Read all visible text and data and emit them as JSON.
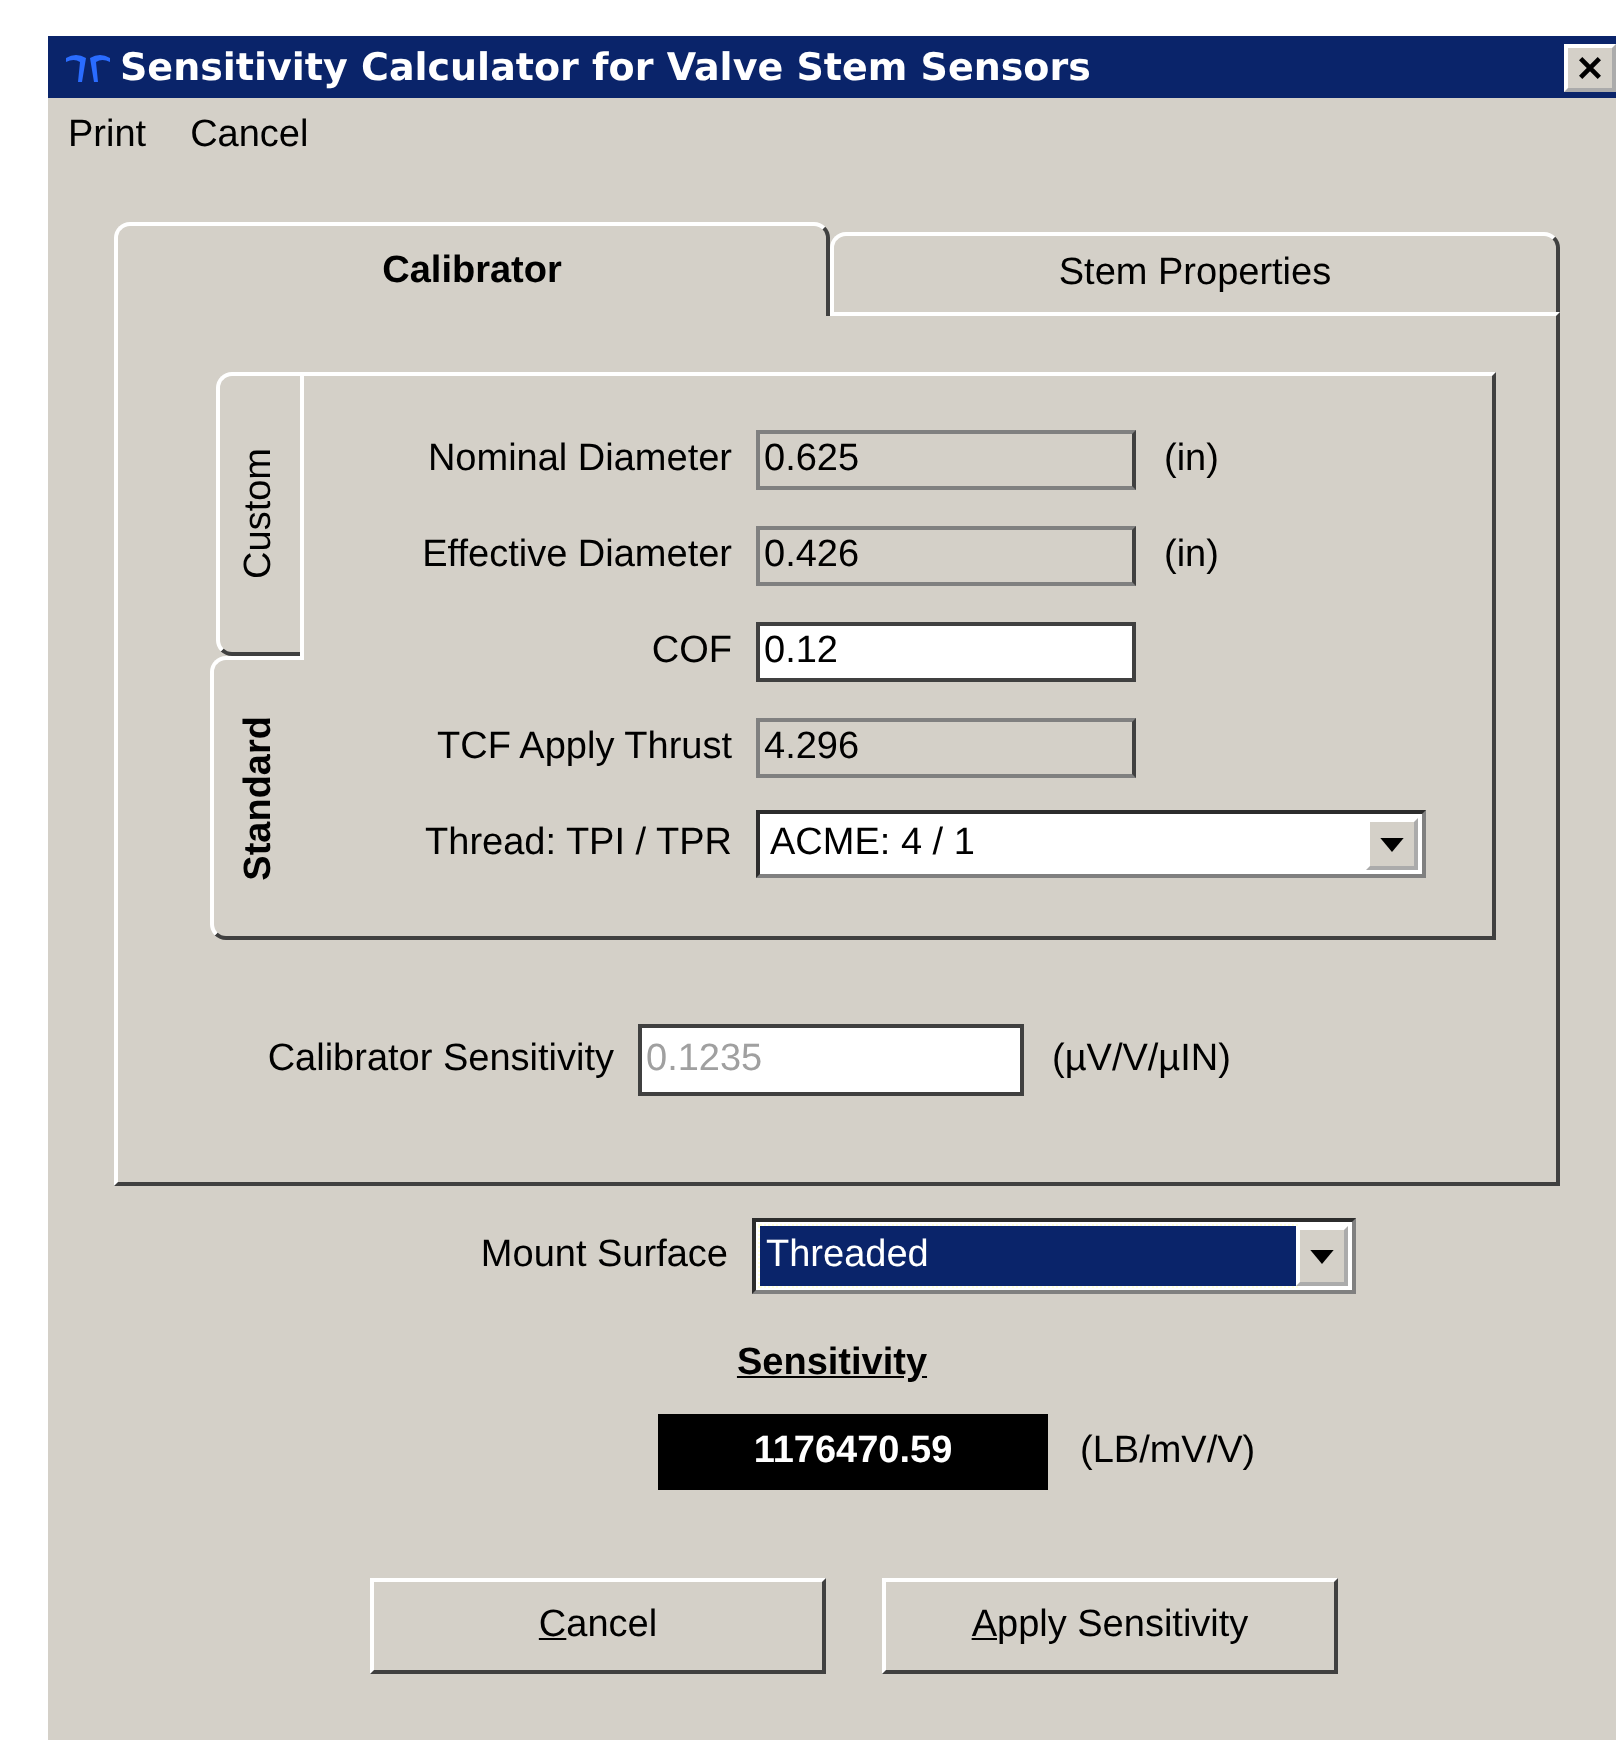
{
  "window": {
    "title": "Sensitivity Calculator for Valve Stem Sensors"
  },
  "menu": [
    {
      "label": "Print"
    },
    {
      "label": "Cancel"
    }
  ],
  "tabs": [
    {
      "label": "Calibrator",
      "selected": true
    },
    {
      "label": "Stem Properties",
      "selected": false
    }
  ],
  "side_tabs": [
    {
      "label": "Custom",
      "selected": false
    },
    {
      "label": "Standard",
      "selected": true
    }
  ],
  "fields": [
    {
      "label": "Nominal Diameter",
      "value": "0.625",
      "kind": "readonly",
      "unit": "(in)"
    },
    {
      "label": "Effective Diameter",
      "value": "0.426",
      "kind": "readonly",
      "unit": "(in)"
    },
    {
      "label": "COF",
      "value": "0.12",
      "kind": "editable"
    },
    {
      "label": "TCF Apply Thrust",
      "value": "4.296",
      "kind": "readonly"
    },
    {
      "label": "Thread: TPI / TPR",
      "value": "ACME: 4 / 1",
      "kind": "dropdown"
    }
  ],
  "calibrator_sensitivity": {
    "label": "Calibrator Sensitivity",
    "value": "0.1235",
    "disabled": true,
    "unit": "(µV/V/µIN)"
  },
  "mount_surface": {
    "label": "Mount Surface",
    "value": "Threaded",
    "focused": true
  },
  "sensitivity": {
    "heading": "Sensitivity",
    "value": "1176470.59",
    "unit": "(LB/mV/V)"
  },
  "buttons": [
    {
      "label": "Cancel"
    },
    {
      "label": "Apply Sensitivity"
    }
  ]
}
